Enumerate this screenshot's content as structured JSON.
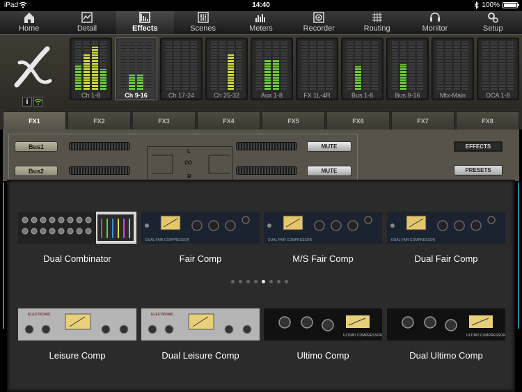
{
  "status": {
    "carrier": "iPad",
    "time": "14:40",
    "battery": "100%"
  },
  "nav": [
    {
      "label": "Home",
      "icon": "home-icon"
    },
    {
      "label": "Detail",
      "icon": "detail-icon"
    },
    {
      "label": "Effects",
      "icon": "effects-icon",
      "active": true
    },
    {
      "label": "Scenes",
      "icon": "scenes-icon"
    },
    {
      "label": "Meters",
      "icon": "meters-icon"
    },
    {
      "label": "Recorder",
      "icon": "recorder-icon"
    },
    {
      "label": "Routing",
      "icon": "routing-icon"
    },
    {
      "label": "Monitor",
      "icon": "monitor-icon"
    },
    {
      "label": "Setup",
      "icon": "setup-icon"
    }
  ],
  "meters": [
    {
      "label": "Ch 1-8",
      "levels": [
        0.5,
        0.75,
        0.88,
        0.43
      ]
    },
    {
      "label": "Ch 9-16",
      "levels": [
        0,
        0.32,
        0.32,
        0
      ],
      "selected": true
    },
    {
      "label": "Ch 17-24",
      "levels": [
        0,
        0,
        0,
        0
      ]
    },
    {
      "label": "Ch 25-32",
      "levels": [
        0,
        0,
        0.75,
        0
      ]
    },
    {
      "label": "Aux 1-8",
      "levels": [
        0,
        0.63,
        0.63,
        0
      ]
    },
    {
      "label": "FX 1L-4R",
      "levels": [
        0,
        0,
        0,
        0
      ]
    },
    {
      "label": "Bus 1-8",
      "levels": [
        0,
        0.48,
        0,
        0
      ]
    },
    {
      "label": "Bus 9-16",
      "levels": [
        0,
        0.53,
        0,
        0
      ]
    },
    {
      "label": "Mtx-Main",
      "levels": [
        0,
        0,
        0,
        0
      ]
    },
    {
      "label": "DCA 1-8",
      "levels": [
        0,
        0,
        0,
        0
      ]
    }
  ],
  "info": {
    "i_label": "i"
  },
  "tabs": [
    "FX1",
    "FX2",
    "FX3",
    "FX4",
    "FX5",
    "FX6",
    "FX7",
    "FX8"
  ],
  "fx": {
    "bus1": "Bus1",
    "bus2": "Bus2",
    "lr_top": "L",
    "lr_bottom": "R",
    "link_symbol": "∞",
    "mute1": "MUTE",
    "mute2": "MUTE",
    "effects": "EFFECTS",
    "presets": "PRESETS"
  },
  "plugins": [
    {
      "name": "Dual Combinator",
      "style": "combinator"
    },
    {
      "name": "Fair Comp",
      "style": "fair"
    },
    {
      "name": "M/S Fair Comp",
      "style": "fair"
    },
    {
      "name": "Dual Fair Comp",
      "style": "fair"
    },
    {
      "name": "Leisure Comp",
      "style": "leisure"
    },
    {
      "name": "Dual Leisure Comp",
      "style": "leisure"
    },
    {
      "name": "Ultimo Comp",
      "style": "ultimo"
    },
    {
      "name": "Dual Ultimo Comp",
      "style": "ultimo"
    }
  ],
  "panel_text": {
    "fair_label": "DUAL FAIR COMPRESSOR",
    "leisure_brand": "ELECTRONIC",
    "ultimo_label": "ULTIMO COMPRESSOR"
  },
  "pages": {
    "count": 8,
    "current": 4
  },
  "colors": {
    "meter_green": "#6cc63c",
    "meter_yellow": "#c8d33a",
    "accent_blue": "#2c8ab2"
  }
}
